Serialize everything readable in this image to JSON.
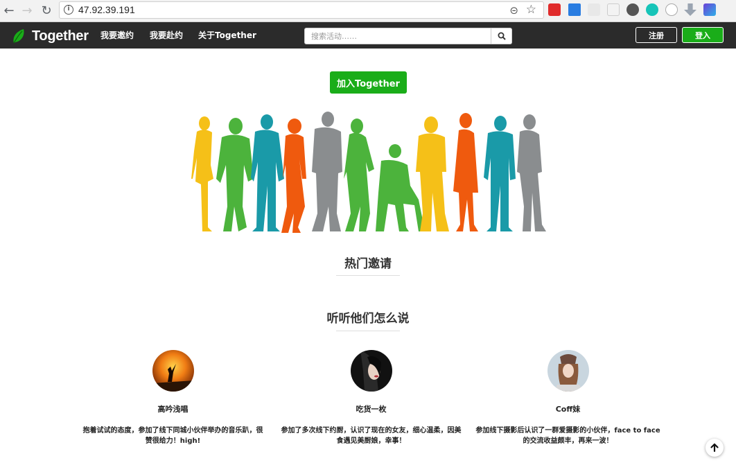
{
  "browser": {
    "url": "47.92.39.191",
    "icons": [
      "back-icon",
      "forward-icon",
      "reload-icon",
      "info-icon",
      "zoom-icon",
      "star-icon"
    ]
  },
  "navbar": {
    "brand": "Together",
    "links": [
      "我要邀约",
      "我要赴约",
      "关于Together"
    ],
    "search_placeholder": "搜索活动……",
    "register": "注册",
    "login": "登入"
  },
  "hero": {
    "join_button": "加入Together"
  },
  "sections": {
    "hot": "热门邀请",
    "testimonials": "听听他们怎么说"
  },
  "testimonials": [
    {
      "name": "高吟浅唱",
      "text": "抱着试试的态度，参加了线下同城小伙伴举办的音乐趴，很赞很给力！high!"
    },
    {
      "name": "吃货一枚",
      "text": "参加了多次线下约厨，认识了现在的女友，细心温柔，因美食遇见美厨娘，幸事！"
    },
    {
      "name": "Coff妹",
      "text": "参加线下摄影后认识了一群爱摄影的小伙伴，face to face的交流收益颇丰，再来一波！"
    }
  ],
  "colors": {
    "navbar": "#2b2b2b",
    "accent": "#1aad19",
    "crowd": [
      "#f5c018",
      "#4cb33c",
      "#1a9aa8",
      "#ef5a0e",
      "#8a8d8f"
    ]
  }
}
